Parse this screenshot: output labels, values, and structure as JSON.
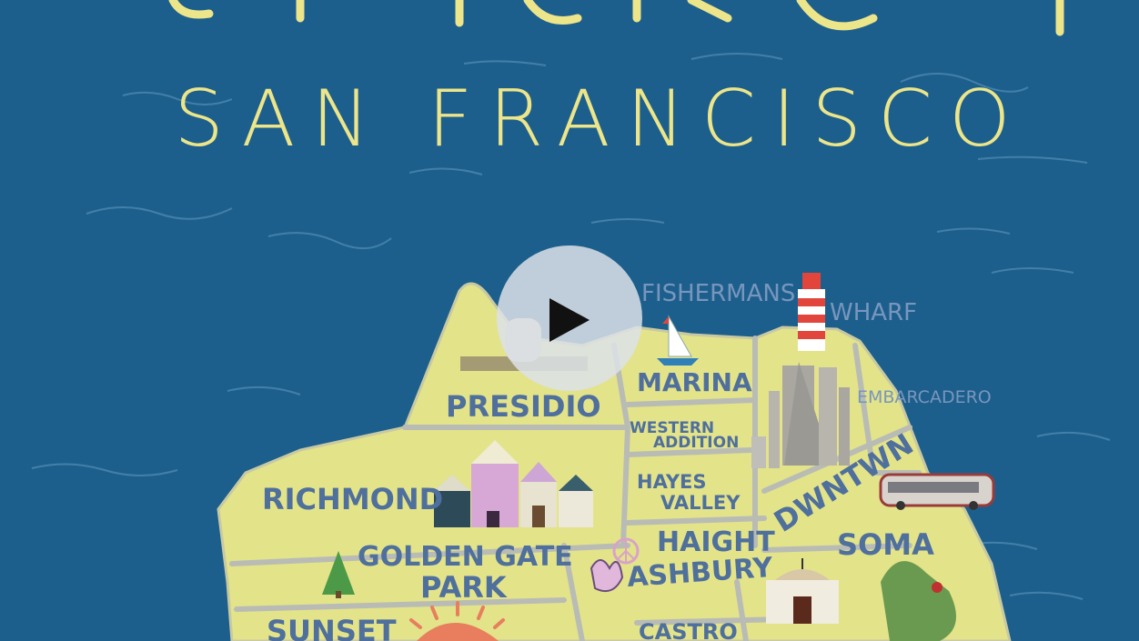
{
  "poster": {
    "title_city": "SAN FRANCISCO"
  },
  "neighborhoods": {
    "fishermans": "FISHERMANS",
    "wharf": "WHARF",
    "marina": "MARINA",
    "presidio": "PRESIDIO",
    "western": "WESTERN",
    "addition": "ADDITION",
    "embarcadero": "EMBARCADERO",
    "hayes": "HAYES",
    "valley": "VALLEY",
    "richmond": "RICHMOND",
    "dwntwn": "DWNTWN",
    "golden_gate": "GOLDEN GATE",
    "park": "PARK",
    "haight": "HAIGHT",
    "ashbury": "ASHBURY",
    "soma": "SOMA",
    "sunset": "SUNSET",
    "castro": "CASTRO"
  },
  "colors": {
    "water": "#1d5f8c",
    "land": "#e3e38a",
    "roads": "#b9bcb4",
    "title": "#ece58a",
    "labels": "#4f6f9c"
  },
  "icons": [
    "play-icon",
    "lighthouse-icon",
    "sailboat-icon",
    "building-icon",
    "bus-icon",
    "tree-icon",
    "peace-icon",
    "houses-icon",
    "church-icon",
    "sun-icon"
  ]
}
